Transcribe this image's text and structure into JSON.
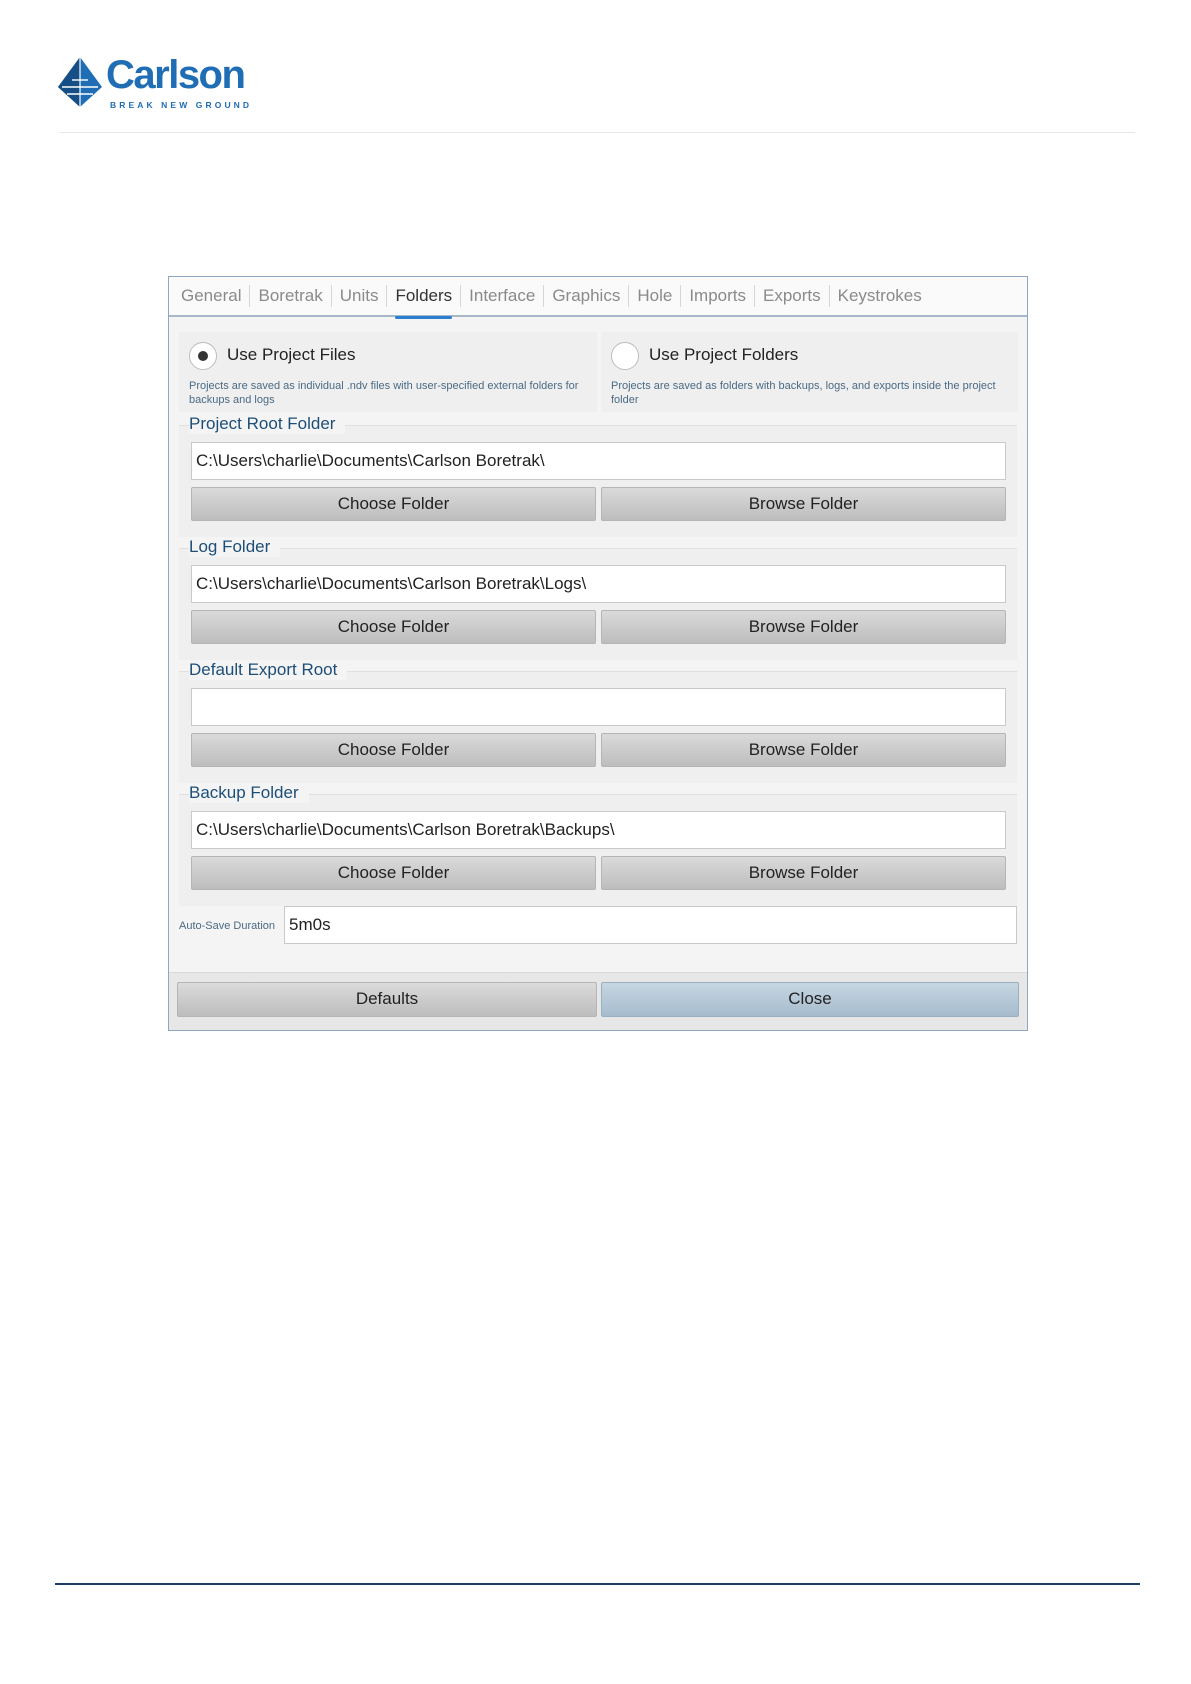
{
  "brand": {
    "name": "Carlson",
    "tagline": "BREAK NEW GROUND",
    "color": "#1f6db5"
  },
  "tabs": [
    {
      "label": "General",
      "active": false
    },
    {
      "label": "Boretrak",
      "active": false
    },
    {
      "label": "Units",
      "active": false
    },
    {
      "label": "Folders",
      "active": true
    },
    {
      "label": "Interface",
      "active": false
    },
    {
      "label": "Graphics",
      "active": false
    },
    {
      "label": "Hole",
      "active": false
    },
    {
      "label": "Imports",
      "active": false
    },
    {
      "label": "Exports",
      "active": false
    },
    {
      "label": "Keystrokes",
      "active": false
    }
  ],
  "modes": {
    "files": {
      "label": "Use Project Files",
      "description": "Projects are saved as individual .ndv files with user-specified external folders for backups and logs",
      "selected": true
    },
    "folders": {
      "label": "Use Project Folders",
      "description": "Projects are saved as folders with backups, logs, and exports inside the project folder",
      "selected": false
    }
  },
  "groups": {
    "project_root": {
      "label": "Project Root Folder",
      "value": "C:\\Users\\charlie\\Documents\\Carlson Boretrak\\"
    },
    "log": {
      "label": "Log Folder",
      "value": "C:\\Users\\charlie\\Documents\\Carlson Boretrak\\Logs\\"
    },
    "export_root": {
      "label": "Default Export Root",
      "value": ""
    },
    "backup": {
      "label": "Backup Folder",
      "value": "C:\\Users\\charlie\\Documents\\Carlson Boretrak\\Backups\\"
    }
  },
  "buttons": {
    "choose": "Choose Folder",
    "browse": "Browse Folder",
    "defaults": "Defaults",
    "close": "Close"
  },
  "autosave": {
    "label": "Auto-Save Duration",
    "value": "5m0s"
  }
}
